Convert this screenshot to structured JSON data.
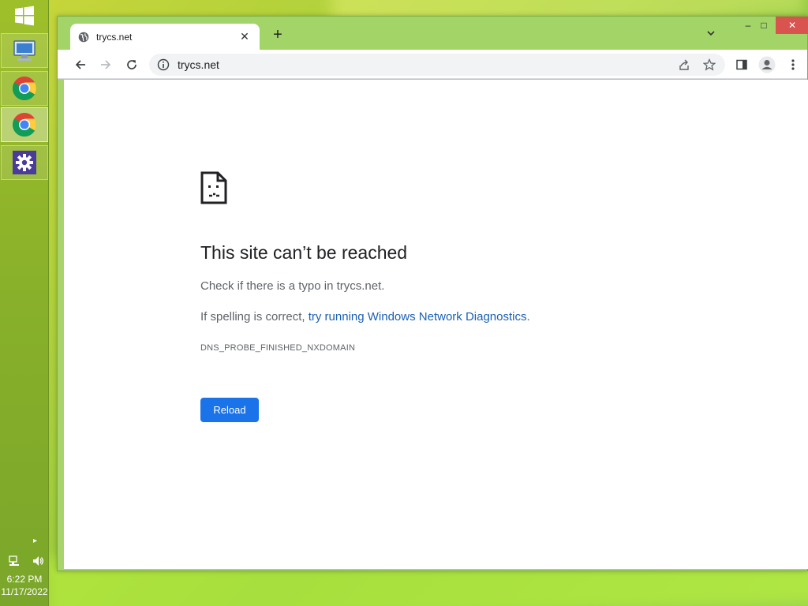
{
  "taskbar": {
    "items": [
      {
        "name": "computer-icon"
      },
      {
        "name": "chrome-icon"
      },
      {
        "name": "chrome-icon"
      },
      {
        "name": "settings-icon"
      }
    ],
    "time": "6:22 PM",
    "date": "11/17/2022"
  },
  "browser": {
    "tab_title": "trycs.net",
    "new_tab_symbol": "+",
    "address": "trycs.net",
    "controls": {
      "minimize": "–",
      "maximize": "□",
      "close": "✕"
    }
  },
  "error": {
    "title": "This site can’t be reached",
    "line1": "Check if there is a typo in trycs.net.",
    "line2_prefix": "If spelling is correct, ",
    "line2_link": "try running Windows Network Diagnostics",
    "line2_suffix": ".",
    "code": "DNS_PROBE_FINISHED_NXDOMAIN",
    "reload_label": "Reload"
  },
  "colors": {
    "accent": "#1a73e8",
    "link": "#1a5fb4",
    "close_button": "#d9534f"
  }
}
